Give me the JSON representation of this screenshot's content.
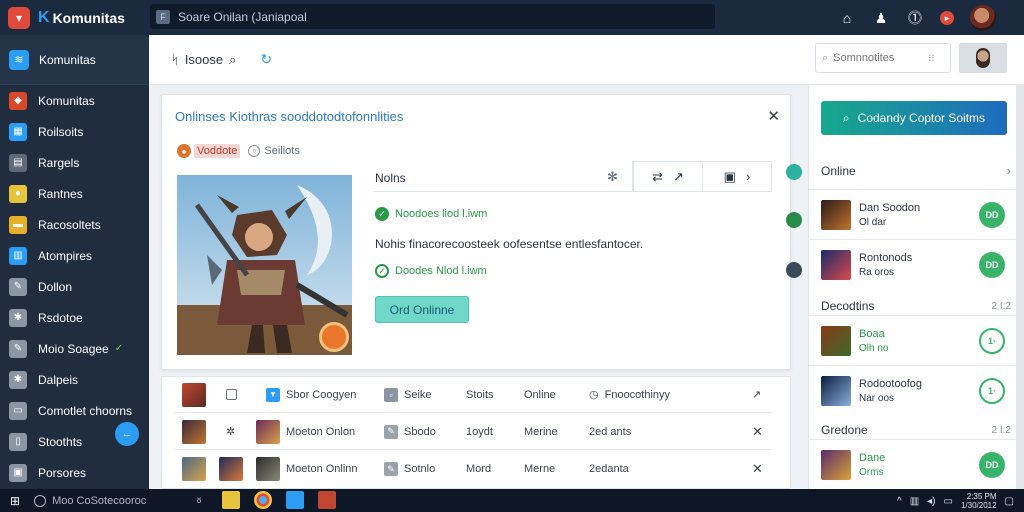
{
  "topbar": {
    "brand": "Komunitas",
    "search_value": "Soare Onilan (Janiapoal",
    "icons": [
      "home-icon",
      "bell-icon",
      "info-icon",
      "flag-icon",
      "user-avatar"
    ]
  },
  "sidebar": {
    "header": "Komunitas",
    "items": [
      {
        "label": "Komunitas",
        "icon": "game-icon",
        "color": "#d9482b"
      },
      {
        "label": "Roilsoits",
        "icon": "grid-icon",
        "color": "#2b9df4"
      },
      {
        "label": "Rargels",
        "icon": "cards-icon",
        "color": "#5f6b79"
      },
      {
        "label": "Rantnes",
        "icon": "coin-icon",
        "color": "#e7c43a"
      },
      {
        "label": "Racosoltets",
        "icon": "folder-icon",
        "color": "#e7b02a"
      },
      {
        "label": "Atompires",
        "icon": "chart-icon",
        "color": "#2b9df4"
      },
      {
        "label": "Dollon",
        "icon": "wrench-icon",
        "color": "#8a96a4"
      },
      {
        "label": "Rsdotoe",
        "icon": "gear-icon",
        "color": "#8a96a4"
      },
      {
        "label": "Moio Soagee",
        "icon": "wrench-icon",
        "color": "#8a96a4"
      },
      {
        "label": "Dalpeis",
        "icon": "gear-icon",
        "color": "#8a96a4"
      },
      {
        "label": "Comotlet choorns",
        "icon": "doc-icon",
        "color": "#8a96a4"
      },
      {
        "label": "Stoothts",
        "icon": "book-icon",
        "color": "#8a96a4"
      },
      {
        "label": "Porsores",
        "icon": "cart-icon",
        "color": "#8a96a4"
      }
    ]
  },
  "header": {
    "title": "Isoose",
    "search_placeholder": "Somnnotites"
  },
  "card": {
    "title": "Onlinses Kiothras sooddotodtofonnlities",
    "tag_red": "Voddote",
    "tag_gray": "Seiliots",
    "panel_title": "Nolns",
    "check1": "Noodoes liod l.iwm",
    "description": "Nohis finacorecoosteek oofesentse entlesfantocer.",
    "check2": "Doodes Nlod l.iwm",
    "button": "Ord Onlinne"
  },
  "table": {
    "header": [
      "Sbor Coogyen",
      "Seike",
      "Stoits",
      "Online",
      "Fnoocothinyy"
    ],
    "rows": [
      {
        "name": "Moeton Onlon",
        "type": "Sbodo",
        "date": "1oydt",
        "status": "Merine",
        "ago": "2ed ants"
      },
      {
        "name": "Moeton Onlinn",
        "type": "Sotnlo",
        "date": "Mord",
        "status": "Merne",
        "ago": "2edanta"
      }
    ]
  },
  "right": {
    "cta": "Codandy Coptor Soitms",
    "online_title": "Online",
    "section2": "Decodtins",
    "section2_right": "2 I:2",
    "section3": "Gredone",
    "section3_right": "2 I:2",
    "items": [
      {
        "line1": "Dan Soodon",
        "line2": "Ol dar",
        "badge": "DD"
      },
      {
        "line1": "Rontonods",
        "line2": "Ra oros",
        "badge": "DD"
      },
      {
        "line1": "Boaa",
        "line2": "Olh no",
        "badge": "1·"
      },
      {
        "line1": "Rodootoofog",
        "line2": "Nar oos",
        "badge": "1·"
      },
      {
        "line1": "Dane",
        "line2": "Orms",
        "badge": "DD"
      }
    ]
  },
  "taskbar": {
    "search": "Moo CoSotecooroc",
    "time": "2:35 PM",
    "date": "1/30/2012"
  }
}
